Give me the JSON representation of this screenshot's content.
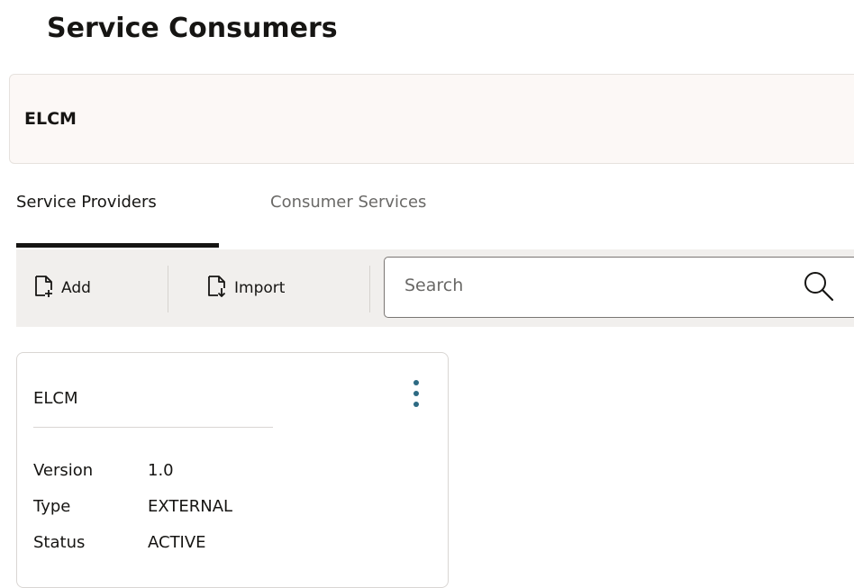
{
  "page": {
    "title": "Service Consumers"
  },
  "context": {
    "title": "ELCM"
  },
  "tabs": [
    {
      "label": "Service Providers",
      "selected": true
    },
    {
      "label": "Consumer Services",
      "selected": false
    }
  ],
  "toolbar": {
    "add_label": "Add",
    "add_icon": "document-add-icon",
    "import_label": "Import",
    "import_icon": "document-import-icon",
    "search": {
      "value": "",
      "placeholder": "Search",
      "icon": "search-icon"
    }
  },
  "cards": [
    {
      "title": "ELCM",
      "menu_icon": "kebab-menu-icon",
      "properties": [
        {
          "label": "Version",
          "value": "1.0"
        },
        {
          "label": "Type",
          "value": "EXTERNAL"
        },
        {
          "label": "Status",
          "value": "ACTIVE"
        }
      ]
    }
  ],
  "colors": {
    "accent": "#2d6a83",
    "text": "#161513",
    "muted": "#6a6967",
    "toolbar_bg": "#f1efed",
    "context_bg": "#fcf8f6"
  }
}
